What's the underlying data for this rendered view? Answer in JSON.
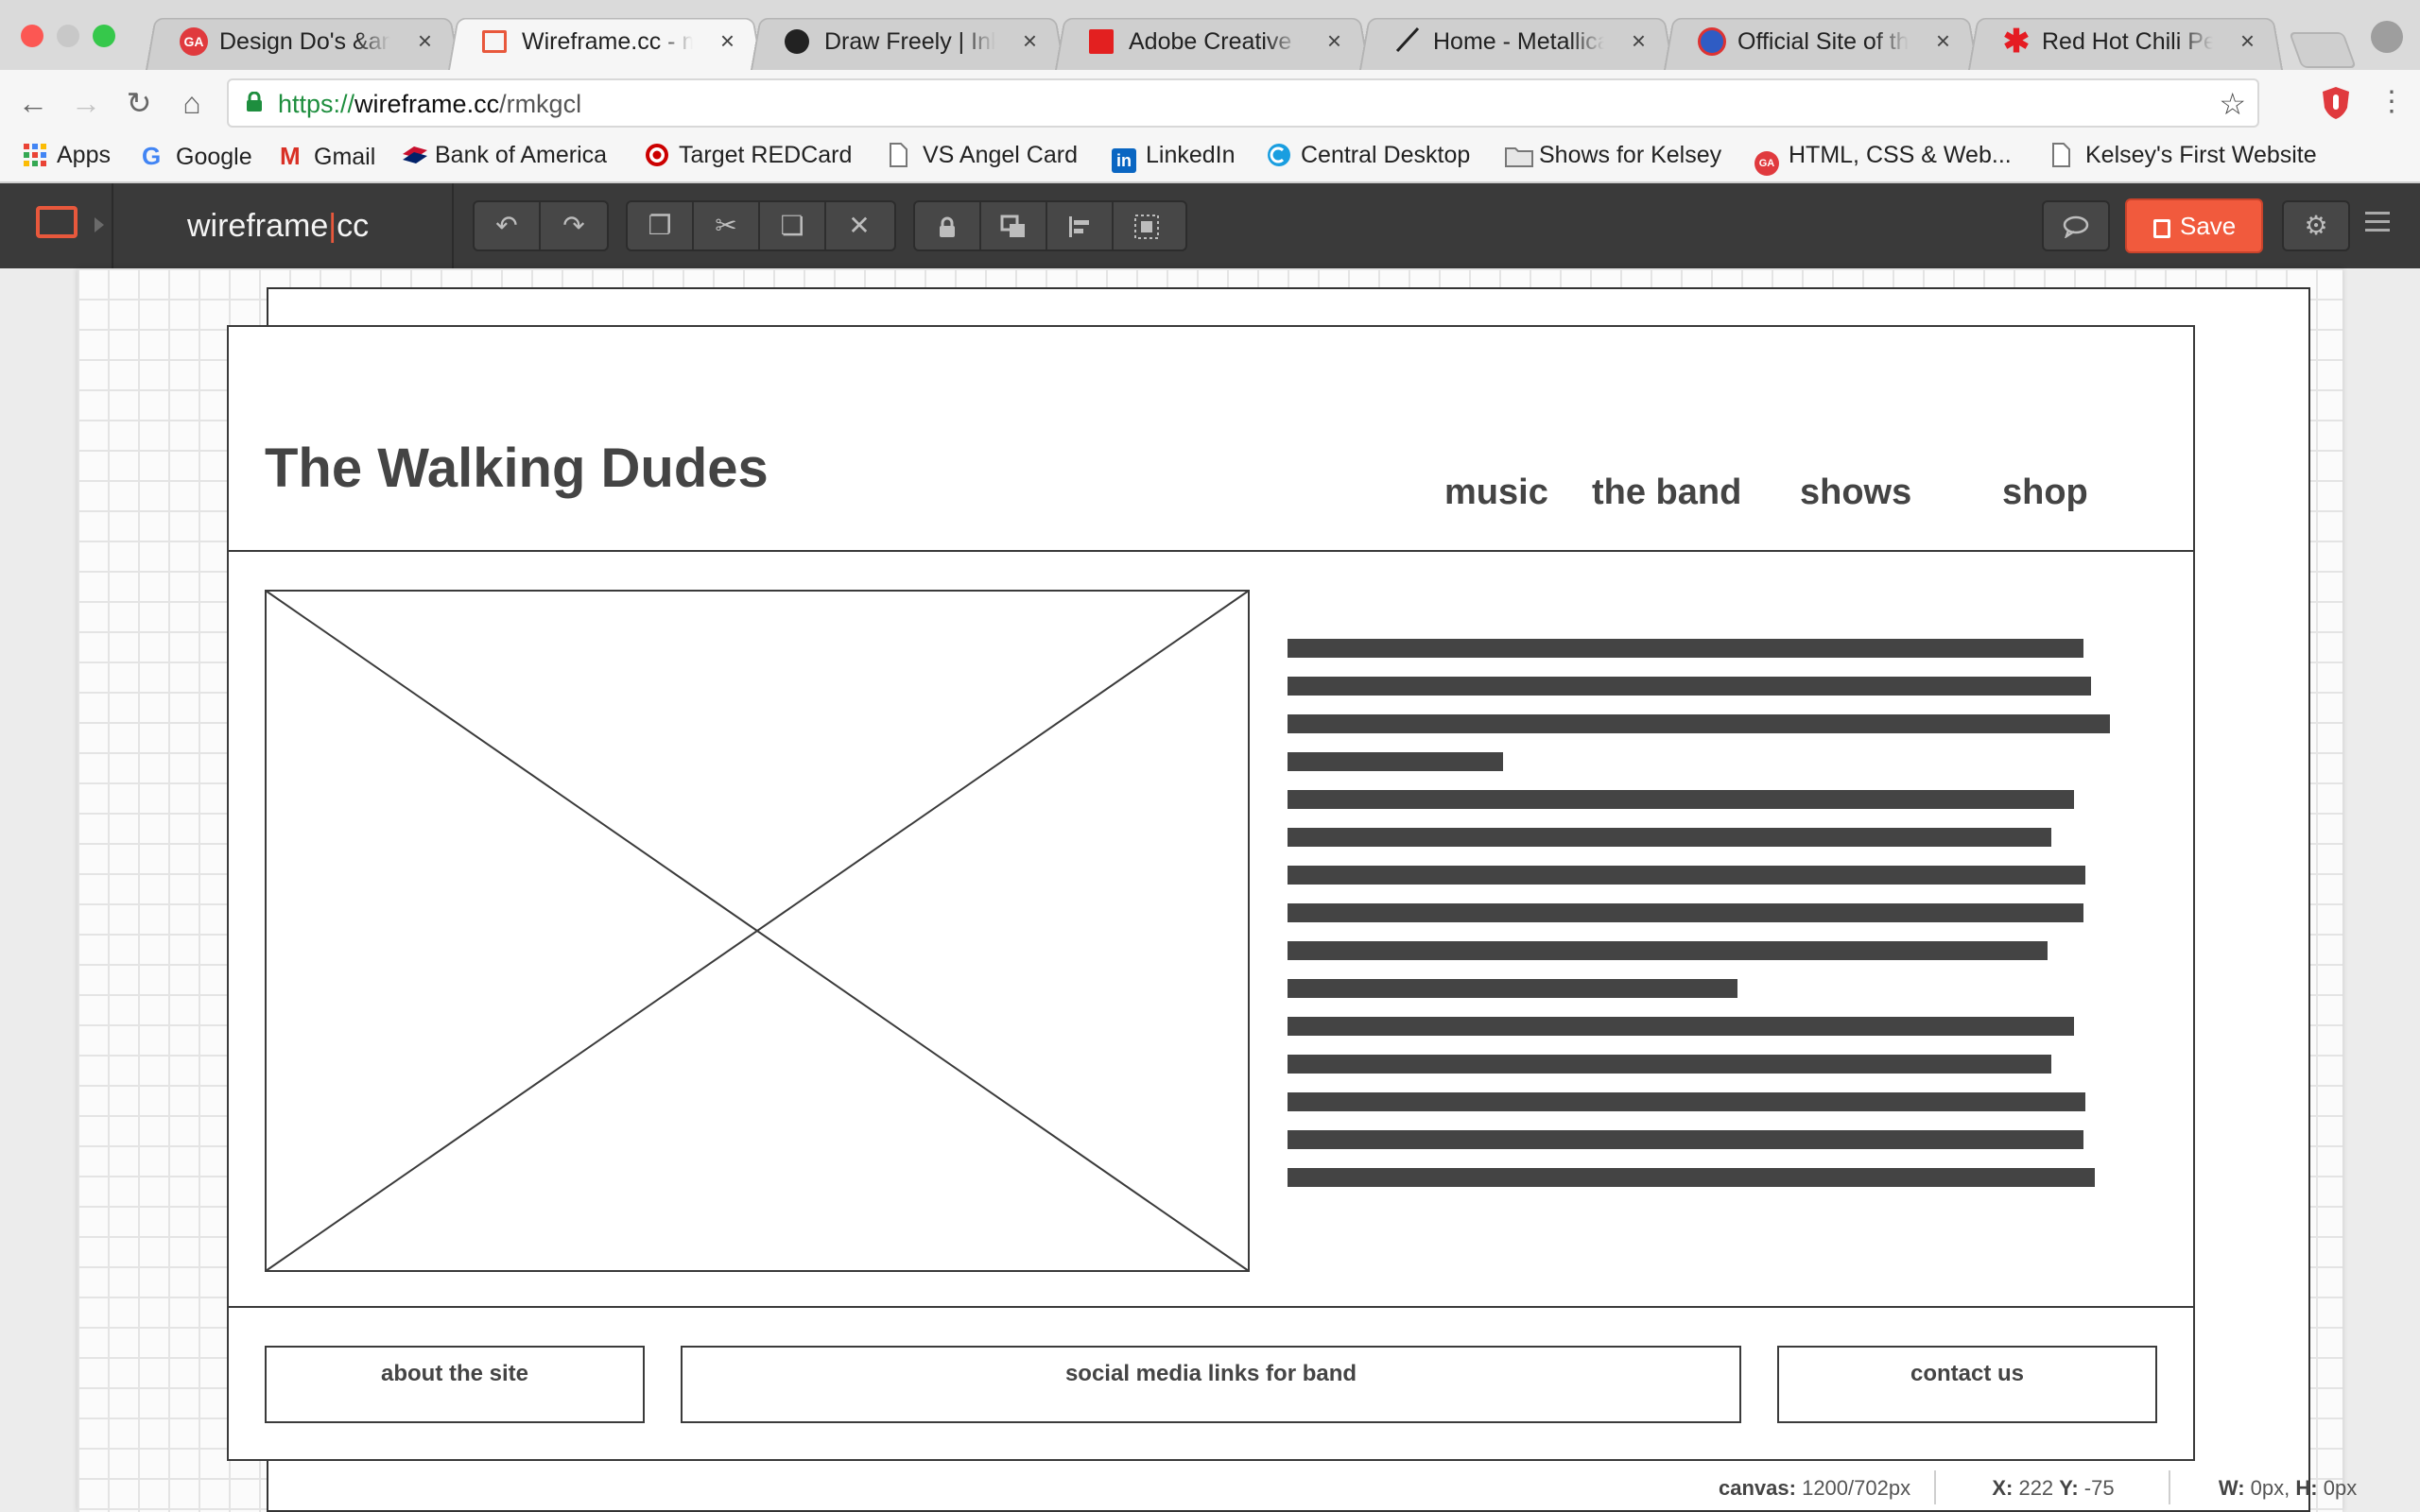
{
  "browser": {
    "tabs": [
      {
        "title": "Design Do's &amp;amp; Don'ts",
        "favicon": "GA"
      },
      {
        "title": "Wireframe.cc - minimal wireframing tool",
        "favicon": ""
      },
      {
        "title": "Draw Freely | Inkscape",
        "favicon": ""
      },
      {
        "title": "Adobe Creative Cloud",
        "favicon": ""
      },
      {
        "title": "Home - Metallica",
        "favicon": ""
      },
      {
        "title": "Official Site of the Grateful Dead",
        "favicon": ""
      },
      {
        "title": "Red Hot Chili Peppers",
        "favicon": ""
      }
    ],
    "close_glyph": "×",
    "url_scheme": "https://",
    "url_host": "wireframe.cc",
    "url_path": "/rmkgcl",
    "bookmarks": [
      {
        "label": "Apps"
      },
      {
        "label": "Google"
      },
      {
        "label": "Gmail"
      },
      {
        "label": "Bank of America"
      },
      {
        "label": "Target REDCard"
      },
      {
        "label": "VS Angel Card"
      },
      {
        "label": "LinkedIn"
      },
      {
        "label": "Central Desktop"
      },
      {
        "label": "Shows for Kelsey"
      },
      {
        "label": "HTML, CSS & Web..."
      },
      {
        "label": "Kelsey's First Website"
      }
    ]
  },
  "app": {
    "brand_left": "wireframe",
    "brand_pipe": "|",
    "brand_right": "cc",
    "save_label": "Save",
    "accent": "#f15a3d"
  },
  "wireframe": {
    "site_title": "The Walking Dudes",
    "nav": [
      "music",
      "the band",
      "shows",
      "shop"
    ],
    "footer": [
      "about the site",
      "social media links for band",
      "contact us"
    ]
  },
  "status": {
    "canvas_label": "canvas:",
    "canvas_value": "1200/702px",
    "x_label": "X:",
    "x_value": "222",
    "y_label": "Y:",
    "y_value": "-75",
    "w_label": "W:",
    "w_value": "0px,",
    "h_label": "H:",
    "h_value": "0px"
  }
}
